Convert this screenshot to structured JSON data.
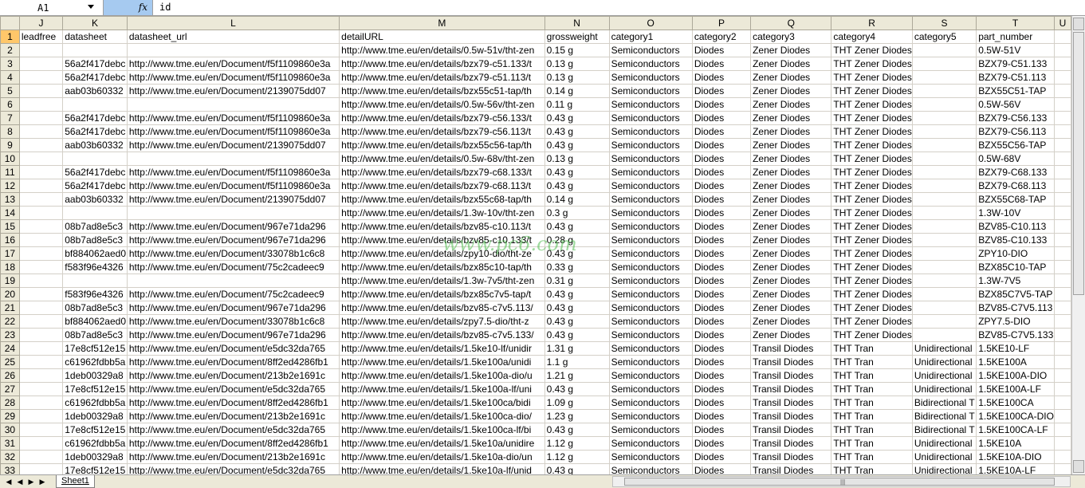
{
  "formula_bar": {
    "name_box": "A1",
    "fx": "fx",
    "formula": "id"
  },
  "columns": [
    {
      "letter": "J",
      "width": 58
    },
    {
      "letter": "K",
      "width": 81
    },
    {
      "letter": "L",
      "width": 271
    },
    {
      "letter": "M",
      "width": 263
    },
    {
      "letter": "N",
      "width": 87
    },
    {
      "letter": "O",
      "width": 111
    },
    {
      "letter": "P",
      "width": 81
    },
    {
      "letter": "Q",
      "width": 111
    },
    {
      "letter": "R",
      "width": 55
    },
    {
      "letter": "S",
      "width": 81
    },
    {
      "letter": "T",
      "width": 91
    },
    {
      "letter": "U",
      "width": 26
    }
  ],
  "rows": [
    {
      "n": "1",
      "cells": [
        "leadfree",
        "datasheet",
        "datasheet_url",
        "detailURL",
        "grossweight",
        "category1",
        "category2",
        "category3",
        "category4",
        "category5",
        "part_number",
        ""
      ]
    },
    {
      "n": "2",
      "cells": [
        "",
        "",
        "",
        "http://www.tme.eu/en/details/0.5w-51v/tht-zen",
        "0.15 g",
        "Semiconductors",
        "Diodes",
        "Zener Diodes",
        "THT Zener Diodes",
        "",
        "0.5W-51V",
        ""
      ]
    },
    {
      "n": "3",
      "cells": [
        "",
        "56a2f417debc",
        "http://www.tme.eu/en/Document/f5f1109860e3a",
        "http://www.tme.eu/en/details/bzx79-c51.133/t",
        "0.13 g",
        "Semiconductors",
        "Diodes",
        "Zener Diodes",
        "THT Zener Diodes",
        "",
        "BZX79-C51.133",
        ""
      ]
    },
    {
      "n": "4",
      "cells": [
        "",
        "56a2f417debc",
        "http://www.tme.eu/en/Document/f5f1109860e3a",
        "http://www.tme.eu/en/details/bzx79-c51.113/t",
        "0.13 g",
        "Semiconductors",
        "Diodes",
        "Zener Diodes",
        "THT Zener Diodes",
        "",
        "BZX79-C51.113",
        ""
      ]
    },
    {
      "n": "5",
      "cells": [
        "",
        "aab03b60332",
        "http://www.tme.eu/en/Document/2139075dd07",
        "http://www.tme.eu/en/details/bzx55c51-tap/th",
        "0.14 g",
        "Semiconductors",
        "Diodes",
        "Zener Diodes",
        "THT Zener Diodes",
        "",
        "BZX55C51-TAP",
        ""
      ]
    },
    {
      "n": "6",
      "cells": [
        "",
        "",
        "",
        "http://www.tme.eu/en/details/0.5w-56v/tht-zen",
        "0.11 g",
        "Semiconductors",
        "Diodes",
        "Zener Diodes",
        "THT Zener Diodes",
        "",
        "0.5W-56V",
        ""
      ]
    },
    {
      "n": "7",
      "cells": [
        "",
        "56a2f417debc",
        "http://www.tme.eu/en/Document/f5f1109860e3a",
        "http://www.tme.eu/en/details/bzx79-c56.133/t",
        "0.43 g",
        "Semiconductors",
        "Diodes",
        "Zener Diodes",
        "THT Zener Diodes",
        "",
        "BZX79-C56.133",
        ""
      ]
    },
    {
      "n": "8",
      "cells": [
        "",
        "56a2f417debc",
        "http://www.tme.eu/en/Document/f5f1109860e3a",
        "http://www.tme.eu/en/details/bzx79-c56.113/t",
        "0.43 g",
        "Semiconductors",
        "Diodes",
        "Zener Diodes",
        "THT Zener Diodes",
        "",
        "BZX79-C56.113",
        ""
      ]
    },
    {
      "n": "9",
      "cells": [
        "",
        "aab03b60332",
        "http://www.tme.eu/en/Document/2139075dd07",
        "http://www.tme.eu/en/details/bzx55c56-tap/th",
        "0.43 g",
        "Semiconductors",
        "Diodes",
        "Zener Diodes",
        "THT Zener Diodes",
        "",
        "BZX55C56-TAP",
        ""
      ]
    },
    {
      "n": "10",
      "cells": [
        "",
        "",
        "",
        "http://www.tme.eu/en/details/0.5w-68v/tht-zen",
        "0.13 g",
        "Semiconductors",
        "Diodes",
        "Zener Diodes",
        "THT Zener Diodes",
        "",
        "0.5W-68V",
        ""
      ]
    },
    {
      "n": "11",
      "cells": [
        "",
        "56a2f417debc",
        "http://www.tme.eu/en/Document/f5f1109860e3a",
        "http://www.tme.eu/en/details/bzx79-c68.133/t",
        "0.43 g",
        "Semiconductors",
        "Diodes",
        "Zener Diodes",
        "THT Zener Diodes",
        "",
        "BZX79-C68.133",
        ""
      ]
    },
    {
      "n": "12",
      "cells": [
        "",
        "56a2f417debc",
        "http://www.tme.eu/en/Document/f5f1109860e3a",
        "http://www.tme.eu/en/details/bzx79-c68.113/t",
        "0.43 g",
        "Semiconductors",
        "Diodes",
        "Zener Diodes",
        "THT Zener Diodes",
        "",
        "BZX79-C68.113",
        ""
      ]
    },
    {
      "n": "13",
      "cells": [
        "",
        "aab03b60332",
        "http://www.tme.eu/en/Document/2139075dd07",
        "http://www.tme.eu/en/details/bzx55c68-tap/th",
        "0.14 g",
        "Semiconductors",
        "Diodes",
        "Zener Diodes",
        "THT Zener Diodes",
        "",
        "BZX55C68-TAP",
        ""
      ]
    },
    {
      "n": "14",
      "cells": [
        "",
        "",
        "",
        "http://www.tme.eu/en/details/1.3w-10v/tht-zen",
        "0.3 g",
        "Semiconductors",
        "Diodes",
        "Zener Diodes",
        "THT Zener Diodes",
        "",
        "1.3W-10V",
        ""
      ]
    },
    {
      "n": "15",
      "cells": [
        "",
        "08b7ad8e5c3",
        "http://www.tme.eu/en/Document/967e71da296",
        "http://www.tme.eu/en/details/bzv85-c10.113/t",
        "0.43 g",
        "Semiconductors",
        "Diodes",
        "Zener Diodes",
        "THT Zener Diodes",
        "",
        "BZV85-C10.113",
        ""
      ]
    },
    {
      "n": "16",
      "cells": [
        "",
        "08b7ad8e5c3",
        "http://www.tme.eu/en/Document/967e71da296",
        "http://www.tme.eu/en/details/bzv85-c10.133/t",
        "0.28 g",
        "Semiconductors",
        "Diodes",
        "Zener Diodes",
        "THT Zener Diodes",
        "",
        "BZV85-C10.133",
        ""
      ]
    },
    {
      "n": "17",
      "cells": [
        "",
        "bf884062aed0",
        "http://www.tme.eu/en/Document/33078b1c6c8",
        "http://www.tme.eu/en/details/zpy10-dio/tht-ze",
        "0.43 g",
        "Semiconductors",
        "Diodes",
        "Zener Diodes",
        "THT Zener Diodes",
        "",
        "ZPY10-DIO",
        ""
      ]
    },
    {
      "n": "18",
      "cells": [
        "",
        "f583f96e4326",
        "http://www.tme.eu/en/Document/75c2cadeec9",
        "http://www.tme.eu/en/details/bzx85c10-tap/th",
        "0.33 g",
        "Semiconductors",
        "Diodes",
        "Zener Diodes",
        "THT Zener Diodes",
        "",
        "BZX85C10-TAP",
        ""
      ]
    },
    {
      "n": "19",
      "cells": [
        "",
        "",
        "",
        "http://www.tme.eu/en/details/1.3w-7v5/tht-zen",
        "0.31 g",
        "Semiconductors",
        "Diodes",
        "Zener Diodes",
        "THT Zener Diodes",
        "",
        "1.3W-7V5",
        ""
      ]
    },
    {
      "n": "20",
      "cells": [
        "",
        "f583f96e4326",
        "http://www.tme.eu/en/Document/75c2cadeec9",
        "http://www.tme.eu/en/details/bzx85c7v5-tap/t",
        "0.43 g",
        "Semiconductors",
        "Diodes",
        "Zener Diodes",
        "THT Zener Diodes",
        "",
        "BZX85C7V5-TAP",
        ""
      ]
    },
    {
      "n": "21",
      "cells": [
        "",
        "08b7ad8e5c3",
        "http://www.tme.eu/en/Document/967e71da296",
        "http://www.tme.eu/en/details/bzv85-c7v5.113/",
        "0.43 g",
        "Semiconductors",
        "Diodes",
        "Zener Diodes",
        "THT Zener Diodes",
        "",
        "BZV85-C7V5.113",
        ""
      ]
    },
    {
      "n": "22",
      "cells": [
        "",
        "bf884062aed0",
        "http://www.tme.eu/en/Document/33078b1c6c8",
        "http://www.tme.eu/en/details/zpy7.5-dio/tht-z",
        "0.43 g",
        "Semiconductors",
        "Diodes",
        "Zener Diodes",
        "THT Zener Diodes",
        "",
        "ZPY7.5-DIO",
        ""
      ]
    },
    {
      "n": "23",
      "cells": [
        "",
        "08b7ad8e5c3",
        "http://www.tme.eu/en/Document/967e71da296",
        "http://www.tme.eu/en/details/bzv85-c7v5.133/",
        "0.43 g",
        "Semiconductors",
        "Diodes",
        "Zener Diodes",
        "THT Zener Diodes",
        "",
        "BZV85-C7V5.133",
        ""
      ]
    },
    {
      "n": "24",
      "cells": [
        "",
        "17e8cf512e15",
        "http://www.tme.eu/en/Document/e5dc32da765",
        "http://www.tme.eu/en/details/1.5ke10-lf/unidir",
        "1.31 g",
        "Semiconductors",
        "Diodes",
        "Transil Diodes",
        "THT Tran",
        "Unidirectional",
        "1.5KE10-LF",
        ""
      ]
    },
    {
      "n": "25",
      "cells": [
        "",
        "c61962fdbb5a",
        "http://www.tme.eu/en/Document/8ff2ed4286fb1",
        "http://www.tme.eu/en/details/1.5ke100a/unidi",
        "1.1 g",
        "Semiconductors",
        "Diodes",
        "Transil Diodes",
        "THT Tran",
        "Unidirectional",
        "1.5KE100A",
        ""
      ]
    },
    {
      "n": "26",
      "cells": [
        "",
        "1deb00329a8",
        "http://www.tme.eu/en/Document/213b2e1691c",
        "http://www.tme.eu/en/details/1.5ke100a-dio/u",
        "1.21 g",
        "Semiconductors",
        "Diodes",
        "Transil Diodes",
        "THT Tran",
        "Unidirectional",
        "1.5KE100A-DIO",
        ""
      ]
    },
    {
      "n": "27",
      "cells": [
        "",
        "17e8cf512e15",
        "http://www.tme.eu/en/Document/e5dc32da765",
        "http://www.tme.eu/en/details/1.5ke100a-lf/uni",
        "0.43 g",
        "Semiconductors",
        "Diodes",
        "Transil Diodes",
        "THT Tran",
        "Unidirectional",
        "1.5KE100A-LF",
        ""
      ]
    },
    {
      "n": "28",
      "cells": [
        "",
        "c61962fdbb5a",
        "http://www.tme.eu/en/Document/8ff2ed4286fb1",
        "http://www.tme.eu/en/details/1.5ke100ca/bidi",
        "1.09 g",
        "Semiconductors",
        "Diodes",
        "Transil Diodes",
        "THT Tran",
        "Bidirectional T",
        "1.5KE100CA",
        ""
      ]
    },
    {
      "n": "29",
      "cells": [
        "",
        "1deb00329a8",
        "http://www.tme.eu/en/Document/213b2e1691c",
        "http://www.tme.eu/en/details/1.5ke100ca-dio/",
        "1.23 g",
        "Semiconductors",
        "Diodes",
        "Transil Diodes",
        "THT Tran",
        "Bidirectional T",
        "1.5KE100CA-DIO",
        ""
      ]
    },
    {
      "n": "30",
      "cells": [
        "",
        "17e8cf512e15",
        "http://www.tme.eu/en/Document/e5dc32da765",
        "http://www.tme.eu/en/details/1.5ke100ca-lf/bi",
        "0.43 g",
        "Semiconductors",
        "Diodes",
        "Transil Diodes",
        "THT Tran",
        "Bidirectional T",
        "1.5KE100CA-LF",
        ""
      ]
    },
    {
      "n": "31",
      "cells": [
        "",
        "c61962fdbb5a",
        "http://www.tme.eu/en/Document/8ff2ed4286fb1",
        "http://www.tme.eu/en/details/1.5ke10a/unidire",
        "1.12 g",
        "Semiconductors",
        "Diodes",
        "Transil Diodes",
        "THT Tran",
        "Unidirectional",
        "1.5KE10A",
        ""
      ]
    },
    {
      "n": "32",
      "cells": [
        "",
        "1deb00329a8",
        "http://www.tme.eu/en/Document/213b2e1691c",
        "http://www.tme.eu/en/details/1.5ke10a-dio/un",
        "1.12 g",
        "Semiconductors",
        "Diodes",
        "Transil Diodes",
        "THT Tran",
        "Unidirectional",
        "1.5KE10A-DIO",
        ""
      ]
    },
    {
      "n": "33",
      "cells": [
        "",
        "17e8cf512e15",
        "http://www.tme.eu/en/Document/e5dc32da765",
        "http://www.tme.eu/en/details/1.5ke10a-lf/unid",
        "0.43 g",
        "Semiconductors",
        "Diodes",
        "Transil Diodes",
        "THT Tran",
        "Unidirectional",
        "1.5KE10A-LF",
        ""
      ]
    }
  ],
  "sheet_tabs": [
    "Sheet1"
  ],
  "watermark": "www.pc6.com",
  "colors": {
    "selected_header": "#ffc76a",
    "fx_box": "#a6caf0",
    "header_bg": "#ece9d8",
    "grid_line": "#d4d0c8"
  }
}
